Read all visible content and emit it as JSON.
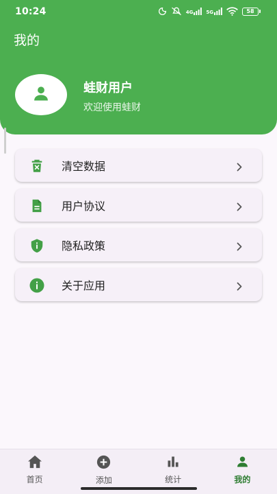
{
  "status_bar": {
    "time": "10:24",
    "network_4g": "4G",
    "network_5g": "5G",
    "battery": "58"
  },
  "header": {
    "title": "我的",
    "user_name": "蛙财用户",
    "user_subtitle": "欢迎使用蛙财"
  },
  "menu": {
    "items": [
      {
        "label": "清空数据",
        "icon": "trash-icon"
      },
      {
        "label": "用户协议",
        "icon": "document-icon"
      },
      {
        "label": "隐私政策",
        "icon": "shield-icon"
      },
      {
        "label": "关于应用",
        "icon": "info-icon"
      }
    ]
  },
  "bottom_nav": {
    "items": [
      {
        "label": "首页",
        "icon": "home-icon"
      },
      {
        "label": "添加",
        "icon": "add-circle-icon"
      },
      {
        "label": "统计",
        "icon": "bar-chart-icon"
      },
      {
        "label": "我的",
        "icon": "person-icon"
      }
    ],
    "active_index": 3
  },
  "colors": {
    "primary": "#4caf50",
    "icon_green": "#43a047",
    "background": "#fbf7fc",
    "card": "#f6f0f8",
    "active_nav": "#2e7d32"
  }
}
